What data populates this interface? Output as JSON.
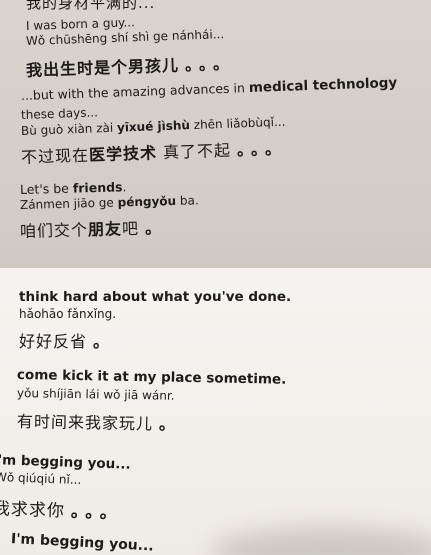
{
  "sections": [
    {
      "header_zh": "我的身材平满的...",
      "english": "I was born a guy...",
      "pinyin": "Wǒ chūshēng shí shì ge nánhái...",
      "chinese": "我出生时是个男孩儿",
      "dots": "。。。"
    },
    {
      "english_prefix": "...but with the amazing advances in ",
      "english_emph": "medical technology",
      "english_cont": "these days...",
      "pinyin_prefix": "Bù guò xiàn zài ",
      "pinyin_emph": "yīxué jìshù",
      "pinyin_suffix": " zhēn liǎobùqǐ...",
      "chinese_prefix": "不过现在",
      "chinese_emph": "医学技术",
      "chinese_suffix": "真了不起",
      "dots": "。。。"
    },
    {
      "english_prefix": "Let's be ",
      "english_emph": "friends",
      "english_suffix": ".",
      "pinyin_prefix": "Zánmen jiāo ge ",
      "pinyin_emph": "péngyǒu",
      "pinyin_suffix": " ba.",
      "chinese_prefix": "咱们交个",
      "chinese_emph": "朋友",
      "chinese_suffix": "吧",
      "dots": "。"
    },
    {
      "english": "think hard about what you've done.",
      "pinyin": "hǎohāo fǎnxǐng.",
      "chinese": "好好反省",
      "dots": "。"
    },
    {
      "english": "come kick it at my place sometime.",
      "pinyin": "yǒu shíjiān lái wǒ jiā wánr.",
      "chinese": "有时间来我家玩儿",
      "dots": "。"
    },
    {
      "english": "I'm begging you...",
      "pinyin": "Wǒ qiúqiú nǐ...",
      "chinese": "我求求你",
      "dots": "。。。"
    },
    {
      "english": "I'm begging you..."
    }
  ]
}
